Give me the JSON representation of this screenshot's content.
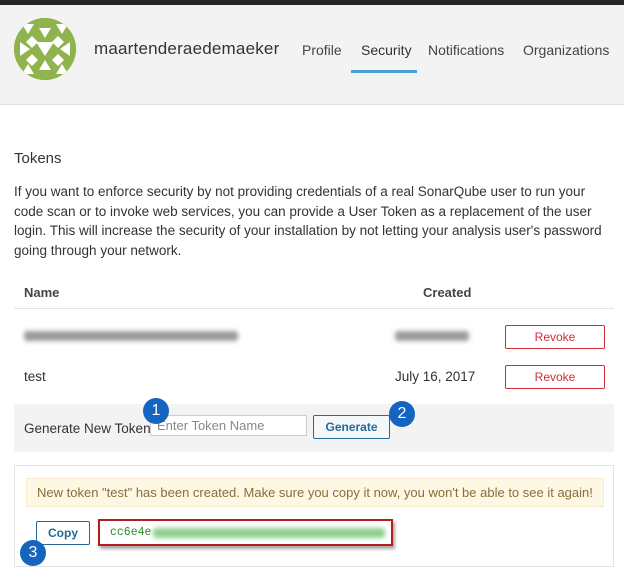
{
  "user": {
    "name": "maartenderaedemaeker"
  },
  "nav": {
    "tabs": [
      "Profile",
      "Security",
      "Notifications",
      "Organizations"
    ],
    "active": "Security"
  },
  "tokens": {
    "title": "Tokens",
    "description": "If you want to enforce security by not providing credentials of a real SonarQube user to run your code scan or to invoke web services, you can provide a User Token as a replacement of the user login. This will increase the security of your installation by not letting your analysis user's password going through your network.",
    "headers": {
      "name": "Name",
      "created": "Created"
    },
    "rows": [
      {
        "name": "",
        "created": "",
        "action": "Revoke"
      },
      {
        "name": "test",
        "created": "July 16, 2017",
        "action": "Revoke"
      }
    ]
  },
  "generate": {
    "label": "Generate New Token:",
    "placeholder": "Enter Token Name",
    "button": "Generate"
  },
  "callouts": [
    "1",
    "2",
    "3"
  ],
  "new_token": {
    "message": "New token \"test\" has been created. Make sure you copy it now, you won't be able to see it again!",
    "copy_label": "Copy",
    "token_prefix": "cc6e4e"
  },
  "colors": {
    "accent": "#4b9fd5",
    "danger": "#d02f3a",
    "primary": "#236a97",
    "callout": "#1565c0",
    "highlight": "#b71c1c",
    "token": "#2a8a2a"
  }
}
